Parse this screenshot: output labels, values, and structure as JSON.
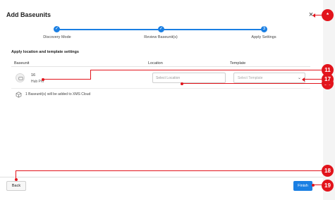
{
  "dialog": {
    "title": "Add Baseunits",
    "close_glyph": "×"
  },
  "stepper": {
    "steps": [
      {
        "label": "Discovery Mode",
        "status": "done",
        "glyph": "✓"
      },
      {
        "label": "Review Baseunit(s)",
        "status": "done",
        "glyph": "✓"
      },
      {
        "label": "Apply Settings",
        "status": "current",
        "glyph": "3"
      }
    ],
    "accent": "#1a7fe3"
  },
  "settings": {
    "section_title": "Apply location and template settings",
    "columns": {
      "baseunit": "Baseunit",
      "location": "Location",
      "template": "Template"
    },
    "rows": [
      {
        "name": "16",
        "type": "Hub Pro",
        "location_placeholder": "Select Location",
        "location_value": "",
        "template_placeholder": "Select Template"
      }
    ],
    "info_icon": "cube-icon",
    "info_text": "1 Baseunit(s) will be added to XMS Cloud"
  },
  "footer": {
    "back_label": "Back",
    "finish_label": "Finish"
  },
  "annotations": {
    "color": "#e2141c",
    "badges": [
      "*",
      "11",
      "16",
      "17",
      "18",
      "19"
    ]
  }
}
